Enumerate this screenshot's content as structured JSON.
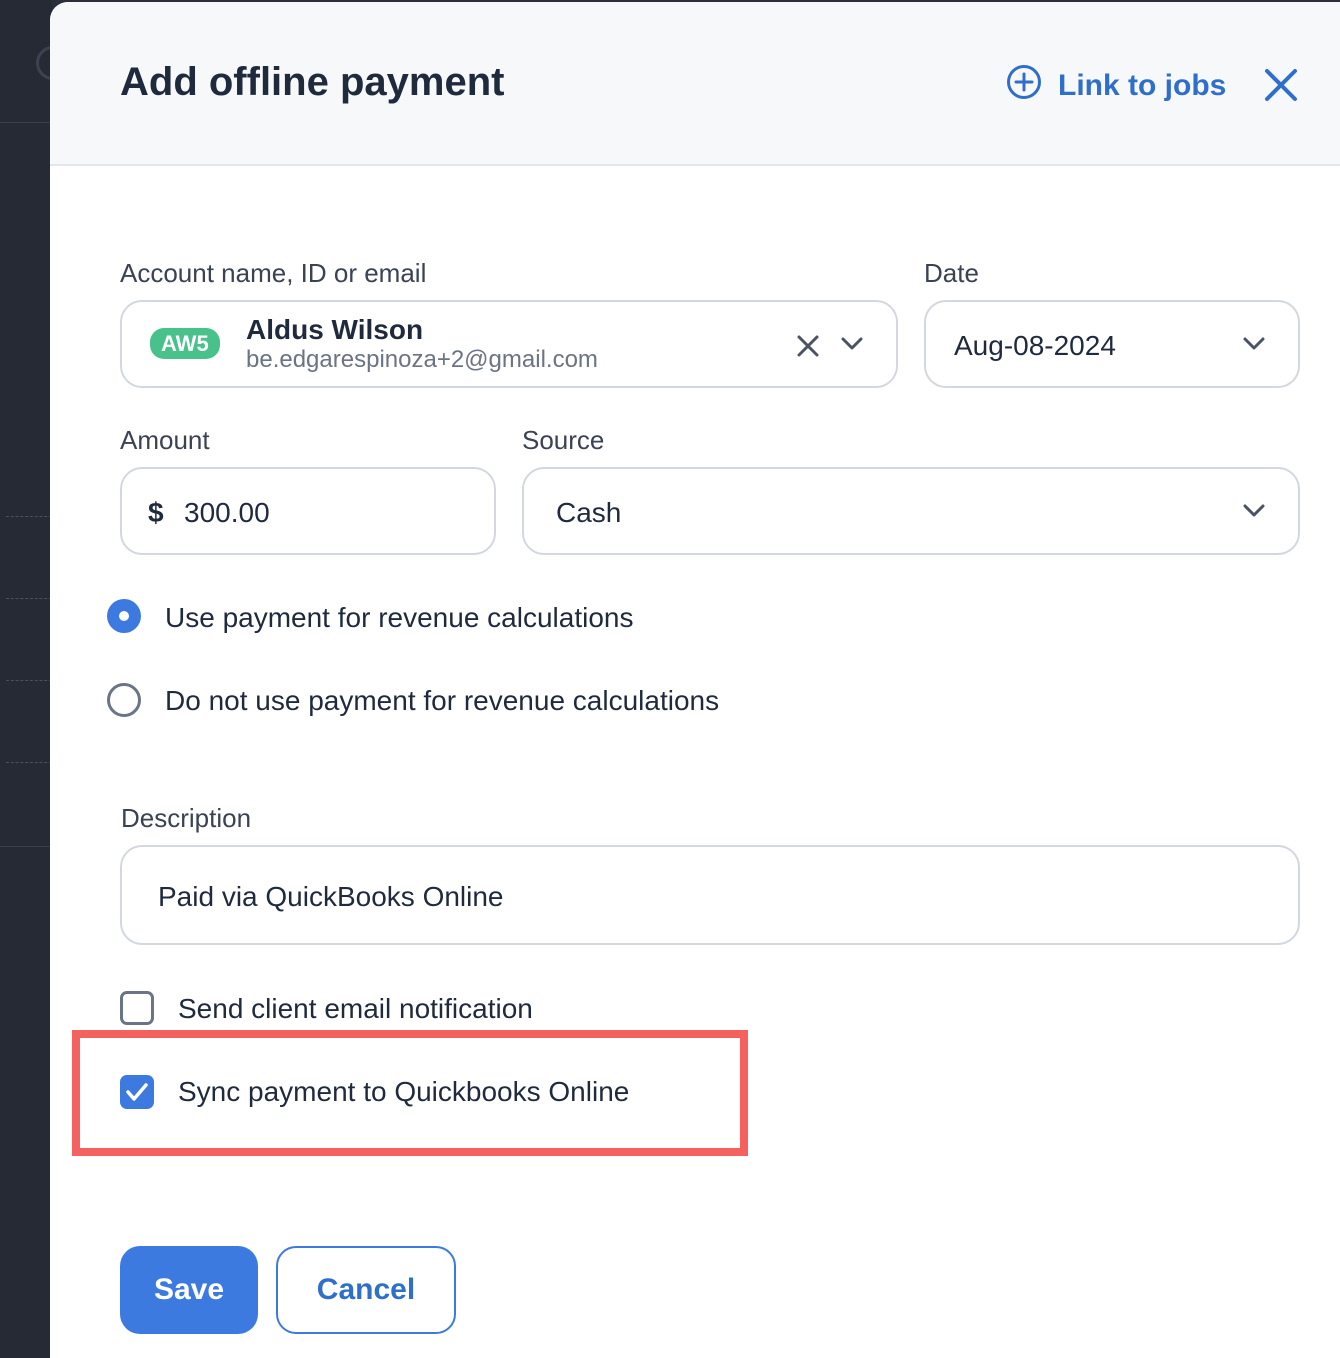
{
  "modal": {
    "title": "Add offline payment",
    "link_to_jobs_label": "Link to jobs"
  },
  "account": {
    "label": "Account name, ID or email",
    "badge": "AW5",
    "name": "Aldus Wilson",
    "email": "be.edgarespinoza+2@gmail.com"
  },
  "date": {
    "label": "Date",
    "value": "Aug-08-2024"
  },
  "amount": {
    "label": "Amount",
    "currency_symbol": "$",
    "value": "300.00"
  },
  "source": {
    "label": "Source",
    "value": "Cash"
  },
  "revenue_options": [
    {
      "label": "Use payment for revenue calculations",
      "selected": true
    },
    {
      "label": "Do not use payment for revenue calculations",
      "selected": false
    }
  ],
  "description": {
    "label": "Description",
    "value": "Paid via QuickBooks Online"
  },
  "checkboxes": {
    "email_notification": {
      "label": "Send client email notification",
      "checked": false
    },
    "sync_quickbooks": {
      "label": "Sync payment to Quickbooks Online",
      "checked": true
    }
  },
  "actions": {
    "save_label": "Save",
    "cancel_label": "Cancel"
  },
  "colors": {
    "accent": "#3d7ae0",
    "link": "#2f6fcb",
    "badge": "#48c28a",
    "highlight": "#f4615e"
  }
}
